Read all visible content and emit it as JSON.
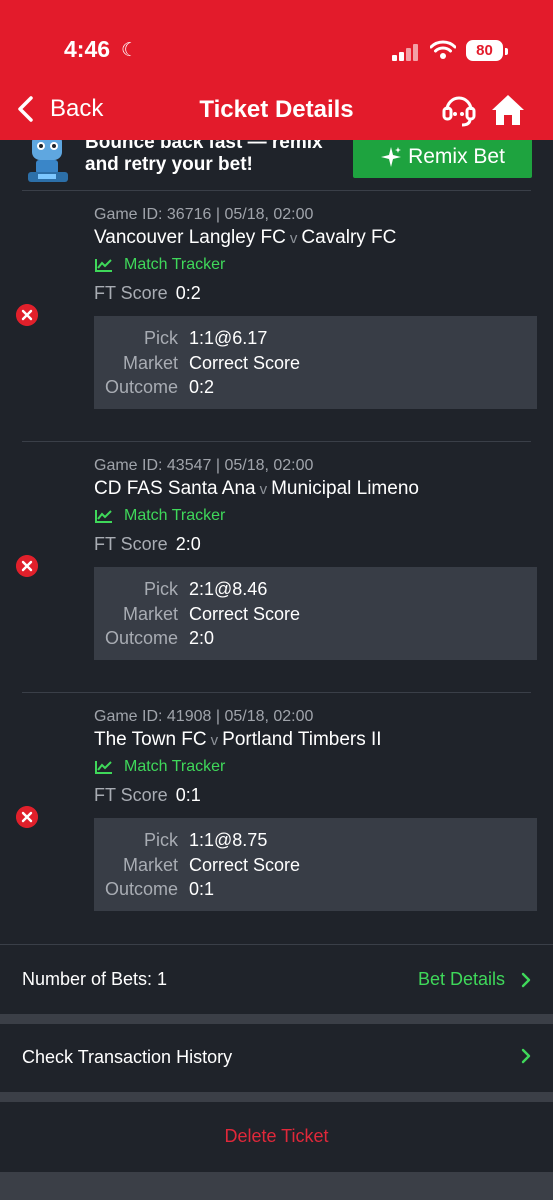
{
  "status_bar": {
    "time": "4:46",
    "battery": "80"
  },
  "header": {
    "back_label": "Back",
    "title": "Ticket Details"
  },
  "banner": {
    "text": "Bounce back fast — remix and retry your bet!",
    "remix_label": "Remix Bet"
  },
  "games": [
    {
      "game_id": "Game ID: 36716 | 05/18, 02:00",
      "home": "Vancouver Langley FC",
      "vs": "v",
      "away": "Cavalry FC",
      "tracker": "Match Tracker",
      "ft_label": "FT Score",
      "ft_score": "0:2",
      "pick_label": "Pick",
      "pick": "1:1@6.17",
      "market_label": "Market",
      "market": "Correct Score",
      "outcome_label": "Outcome",
      "outcome": "0:2"
    },
    {
      "game_id": "Game ID: 43547 | 05/18, 02:00",
      "home": "CD FAS Santa Ana",
      "vs": "v",
      "away": "Municipal Limeno",
      "tracker": "Match Tracker",
      "ft_label": "FT Score",
      "ft_score": "2:0",
      "pick_label": "Pick",
      "pick": "2:1@8.46",
      "market_label": "Market",
      "market": "Correct Score",
      "outcome_label": "Outcome",
      "outcome": "2:0"
    },
    {
      "game_id": "Game ID: 41908 | 05/18, 02:00",
      "home": "The Town FC",
      "vs": "v",
      "away": "Portland Timbers II",
      "tracker": "Match Tracker",
      "ft_label": "FT Score",
      "ft_score": "0:1",
      "pick_label": "Pick",
      "pick": "1:1@8.75",
      "market_label": "Market",
      "market": "Correct Score",
      "outcome_label": "Outcome",
      "outcome": "0:1"
    }
  ],
  "footer": {
    "bets_label": "Number of Bets: 1",
    "bet_details_label": "Bet Details",
    "transactions_label": "Check Transaction History",
    "delete_label": "Delete Ticket"
  },
  "colors": {
    "brand_red": "#e31b2b",
    "accent_green": "#3fd85a",
    "button_green": "#1ea33f",
    "background": "#1f232a",
    "danger": "#e0283a"
  },
  "icons": [
    "moon-icon",
    "signal-icon",
    "wifi-icon",
    "battery-icon",
    "back-chevron-icon",
    "support-headset-icon",
    "home-icon",
    "mascot-icon",
    "sparkle-icon",
    "chart-line-icon",
    "lost-x-icon",
    "chevron-right-icon"
  ]
}
